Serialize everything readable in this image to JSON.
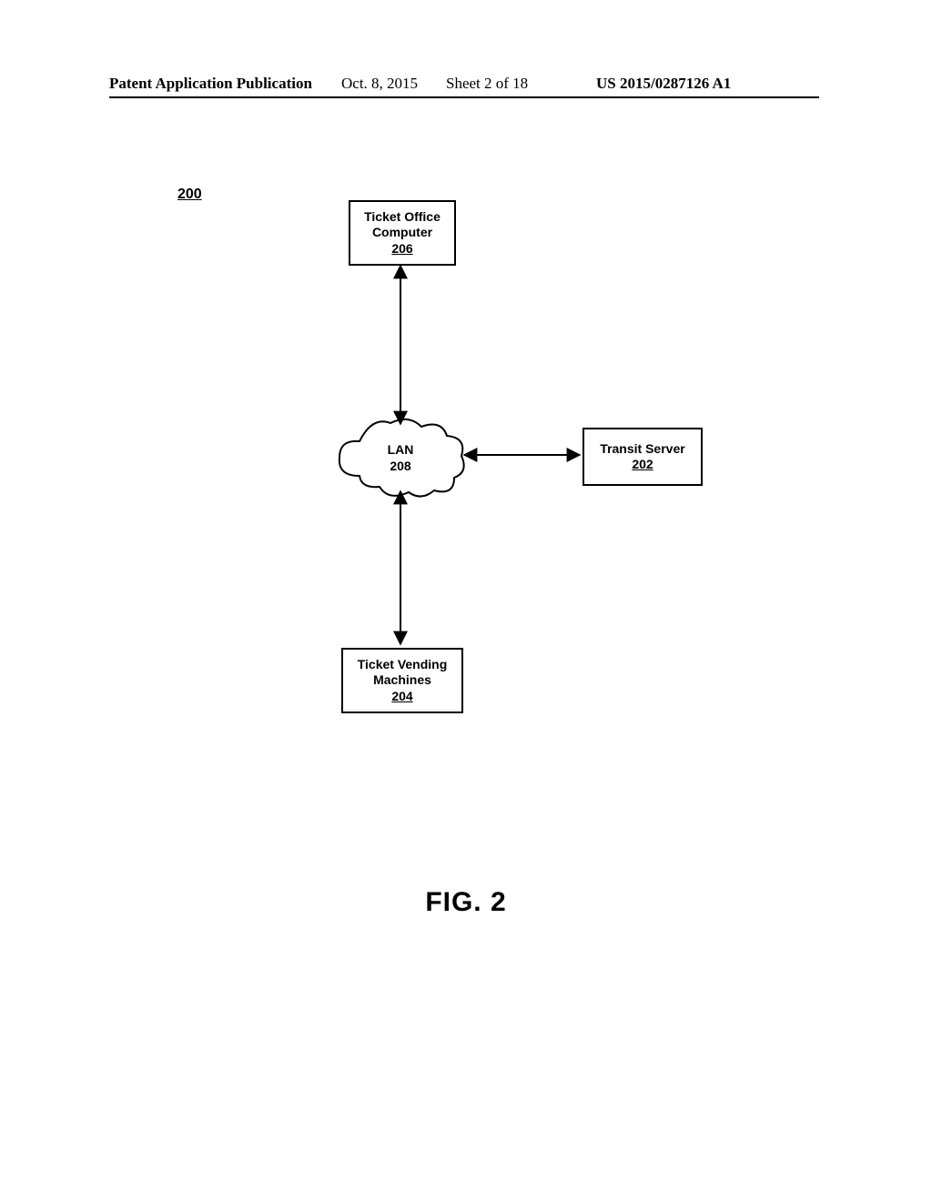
{
  "header": {
    "publication": "Patent Application Publication",
    "date": "Oct. 8, 2015",
    "sheet": "Sheet 2 of 18",
    "docnum": "US 2015/0287126 A1"
  },
  "figure": {
    "ref": "200",
    "caption": "FIG. 2",
    "nodes": {
      "ticketOffice": {
        "title": "Ticket Office Computer",
        "ref": "206"
      },
      "lan": {
        "title": "LAN",
        "ref": "208"
      },
      "transitServer": {
        "title": "Transit Server",
        "ref": "202"
      },
      "ticketVending": {
        "title": "Ticket Vending Machines",
        "ref": "204"
      }
    }
  }
}
